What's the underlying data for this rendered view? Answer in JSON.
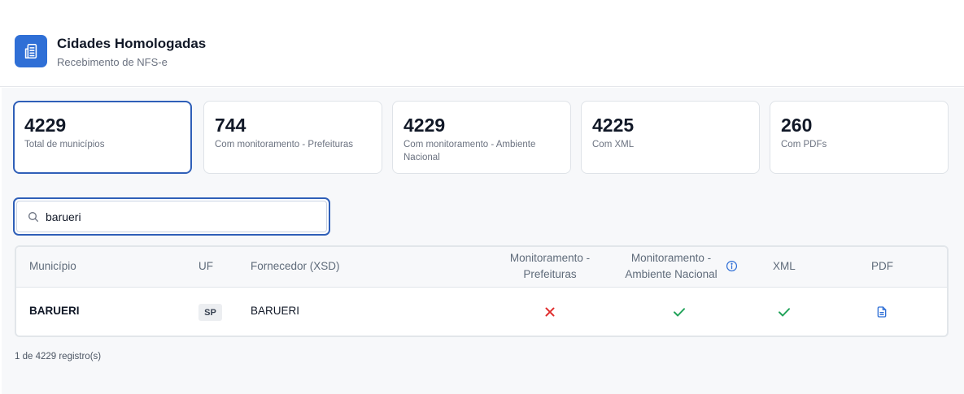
{
  "header": {
    "title": "Cidades Homologadas",
    "subtitle": "Recebimento de NFS-e",
    "logo_icon": "building-document-icon",
    "accent_color": "#2f6fd6"
  },
  "stats": [
    {
      "value": "4229",
      "label": "Total de municípios",
      "selected": true
    },
    {
      "value": "744",
      "label": "Com monitoramento - Prefeituras",
      "selected": false
    },
    {
      "value": "4229",
      "label": "Com monitoramento - Ambiente Nacional",
      "selected": false
    },
    {
      "value": "4225",
      "label": "Com XML",
      "selected": false
    },
    {
      "value": "260",
      "label": "Com PDFs",
      "selected": false
    }
  ],
  "search": {
    "value": "barueri",
    "icon": "search-icon"
  },
  "table": {
    "columns": {
      "municipio": "Município",
      "uf": "UF",
      "fornecedor": "Fornecedor (XSD)",
      "mon_pref_1": "Monitoramento -",
      "mon_pref_2": "Prefeituras",
      "mon_nac_1": "Monitoramento -",
      "mon_nac_2": "Ambiente Nacional",
      "xml": "XML",
      "pdf": "PDF"
    },
    "rows": [
      {
        "municipio": "BARUERI",
        "uf": "SP",
        "fornecedor": "BARUERI",
        "monitoramento_prefeituras": "x-icon",
        "monitoramento_ambiente_nacional": "check-icon",
        "xml": "check-icon",
        "pdf": "document-icon"
      }
    ]
  },
  "colors": {
    "error": "#e02d2d",
    "success": "#22a35a",
    "info": "#2f6fd6"
  },
  "footer": {
    "record_count": "1 de 4229 registro(s)"
  }
}
